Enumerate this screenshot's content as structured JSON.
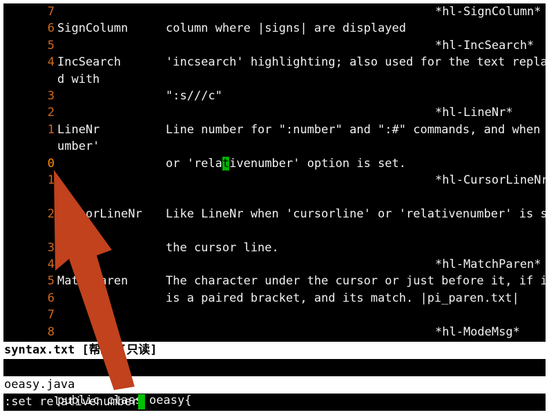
{
  "help_window": {
    "lines": [
      {
        "num": "7",
        "c1": "",
        "c2": "",
        "tag": "*hl-SignColumn*"
      },
      {
        "num": "6",
        "c1": "SignColumn",
        "c2": "column where |signs| are displayed",
        "tag": ""
      },
      {
        "num": "5",
        "c1": "",
        "c2": "",
        "tag": "*hl-IncSearch*"
      },
      {
        "num": "4",
        "c1": "IncSearch",
        "c2": "'incsearch' highlighting; also used for the text replace",
        "tag": ""
      },
      {
        "num": "",
        "c1": "d with",
        "c2": "",
        "tag": ""
      },
      {
        "num": "3",
        "c1": "",
        "c2": "\":s///c\"",
        "tag": ""
      },
      {
        "num": "2",
        "c1": "",
        "c2": "",
        "tag": "*hl-LineNr*"
      },
      {
        "num": "1",
        "c1": "LineNr",
        "c2": "Line number for \":number\" and \":#\" commands, and when 'n",
        "tag": ""
      },
      {
        "num": "",
        "c1": "umber'",
        "c2": "",
        "tag": ""
      },
      {
        "num": "0",
        "c1": "",
        "c2": "or 'relativenumber' option is set.",
        "tag": ""
      },
      {
        "num": "1",
        "c1": "",
        "c2": "",
        "tag": "*hl-CursorLineNr"
      },
      {
        "num": "",
        "c1": "",
        "c2": "",
        "tag": ""
      },
      {
        "num": "2",
        "c1": "CursorLineNr",
        "c2": "Like LineNr when 'cursorline' or 'relativenumber' is set",
        "tag": ""
      },
      {
        "num": "",
        "c1": "",
        "c2": "",
        "tag": ""
      },
      {
        "num": "3",
        "c1": "",
        "c2": "the cursor line.",
        "tag": ""
      },
      {
        "num": "4",
        "c1": "",
        "c2": "",
        "tag": "*hl-MatchParen*"
      },
      {
        "num": "5",
        "c1": "MatchParen",
        "c2": "The character under the cursor or just before it, if it",
        "tag": ""
      },
      {
        "num": "6",
        "c1": "",
        "c2": "is a paired bracket, and its match. |pi_paren.txt|",
        "tag": ""
      },
      {
        "num": "7",
        "c1": "",
        "c2": "",
        "tag": ""
      },
      {
        "num": "8",
        "c1": "",
        "c2": "",
        "tag": "*hl-ModeMsg*"
      }
    ],
    "cursor_line": {
      "before": "or 'rela",
      "char": "t",
      "after": "ivenumber' option is set."
    },
    "status": "syntax.txt [帮助][只读]"
  },
  "java_window": {
    "line_num": "1",
    "text": "public class oeasy{",
    "status": "oeasy.java"
  },
  "command_line": ":set relativenumber",
  "colors": {
    "line_number": "#d2691e",
    "cursor": "#00b000",
    "arrow": "#c1421c"
  }
}
